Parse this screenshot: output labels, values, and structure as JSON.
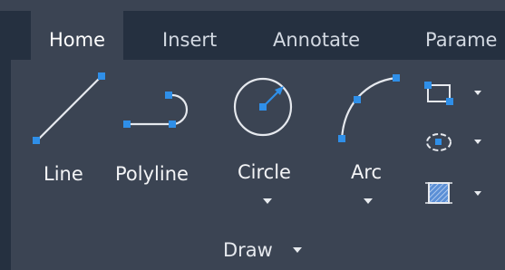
{
  "ribbon": {
    "tabs": [
      {
        "label": "Home",
        "active": true
      },
      {
        "label": "Insert",
        "active": false
      },
      {
        "label": "Annotate",
        "active": false
      },
      {
        "label": "Parame",
        "active": false
      }
    ]
  },
  "draw_panel": {
    "title": "Draw",
    "tools": [
      {
        "label": "Line",
        "icon": "line-icon"
      },
      {
        "label": "Polyline",
        "icon": "polyline-icon"
      },
      {
        "label": "Circle",
        "icon": "circle-icon",
        "has_dropdown": true
      },
      {
        "label": "Arc",
        "icon": "arc-icon",
        "has_dropdown": true
      }
    ],
    "small_tools": [
      {
        "icon": "rectangle-icon",
        "has_dropdown": true
      },
      {
        "icon": "ellipse-icon",
        "has_dropdown": true
      },
      {
        "icon": "hatch-icon",
        "has_dropdown": true
      }
    ]
  },
  "colors": {
    "tab_bar": "#253040",
    "panel_bg": "#3b4453",
    "icon_stroke": "#e6e9ee",
    "grip_blue": "#2f8fe8"
  }
}
